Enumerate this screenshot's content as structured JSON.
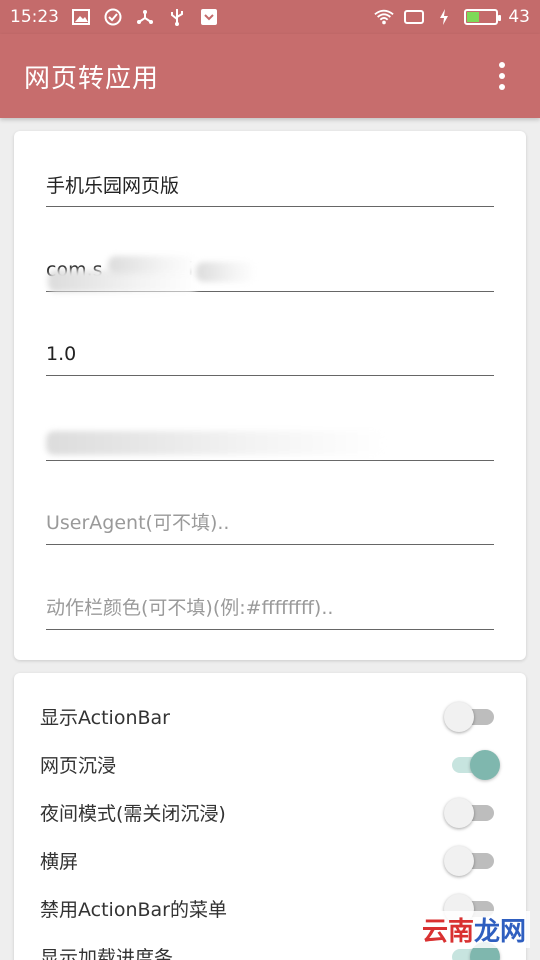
{
  "status_bar": {
    "time": "15:23",
    "battery_level": "43",
    "icons_left": [
      "image-icon",
      "check-circle-icon",
      "share-icon",
      "usb-icon",
      "download-icon"
    ],
    "icons_right": [
      "wifi-icon",
      "screen-icon",
      "charging-icon",
      "battery-icon"
    ]
  },
  "app_bar": {
    "title": "网页转应用",
    "overflow_icon": "more-vert-icon"
  },
  "form": {
    "app_name_value": "手机乐园网页版",
    "package_value": "com.s",
    "package_suffix": "i",
    "version_value": "1.0",
    "url_value": "",
    "user_agent_placeholder": "UserAgent(可不填)..",
    "actionbar_color_placeholder": "动作栏颜色(可不填)(例:#ffffffff).."
  },
  "toggles": [
    {
      "label": "显示ActionBar",
      "state": "off"
    },
    {
      "label": "网页沉浸",
      "state": "on"
    },
    {
      "label": "夜间模式(需关闭沉浸)",
      "state": "off"
    },
    {
      "label": "横屏",
      "state": "off"
    },
    {
      "label": "禁用ActionBar的菜单",
      "state": "off"
    },
    {
      "label": "显示加载进度条",
      "state": "on"
    }
  ],
  "watermark": {
    "part1": "云南",
    "part2": "龙网"
  },
  "colors": {
    "primary": "#c76d6d",
    "accent": "#7fb7ae",
    "background": "#eeeeee"
  }
}
